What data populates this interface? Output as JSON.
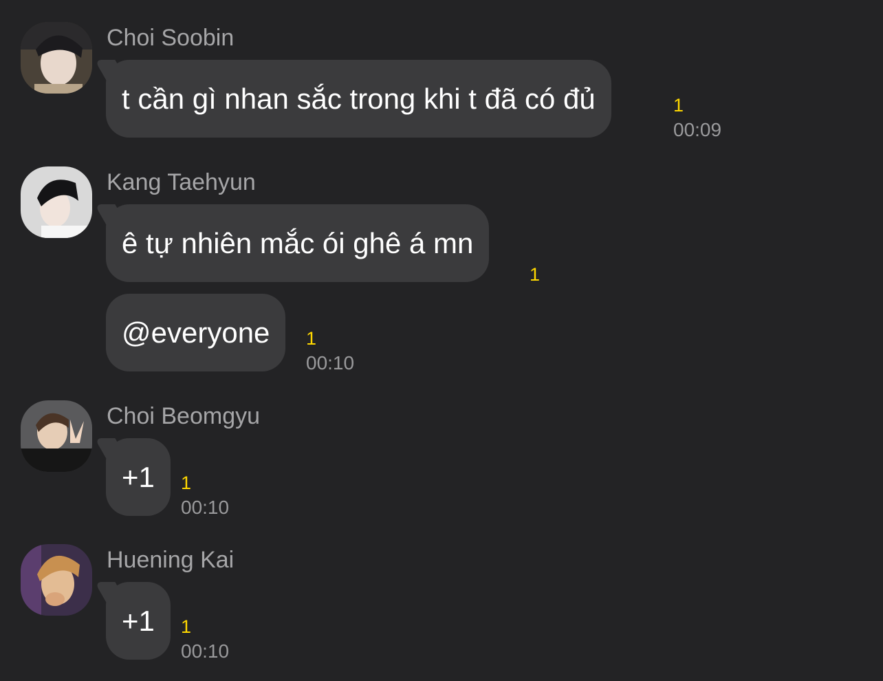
{
  "messages": [
    {
      "sender": "Choi Soobin",
      "avatar": "avatar-photo",
      "bubbles": [
        {
          "text": "t cần gì nhan sắc trong khi t đã có đủ",
          "unread": "1",
          "time": "00:09"
        }
      ]
    },
    {
      "sender": "Kang Taehyun",
      "avatar": "avatar-photo",
      "bubbles": [
        {
          "text": "ê tự nhiên mắc ói ghê á mn",
          "unread": "1",
          "time": ""
        },
        {
          "text": "@everyone",
          "unread": "1",
          "time": "00:10"
        }
      ]
    },
    {
      "sender": "Choi Beomgyu",
      "avatar": "avatar-photo",
      "bubbles": [
        {
          "text": "+1",
          "unread": "1",
          "time": "00:10"
        }
      ]
    },
    {
      "sender": "Huening Kai",
      "avatar": "avatar-photo",
      "bubbles": [
        {
          "text": "+1",
          "unread": "1",
          "time": "00:10"
        }
      ]
    }
  ],
  "colors": {
    "background": "#232325",
    "bubble": "#3b3b3d",
    "unread_count": "#ffd800",
    "sender_name": "#a6a6a8",
    "timestamp": "#9a9a9c"
  }
}
